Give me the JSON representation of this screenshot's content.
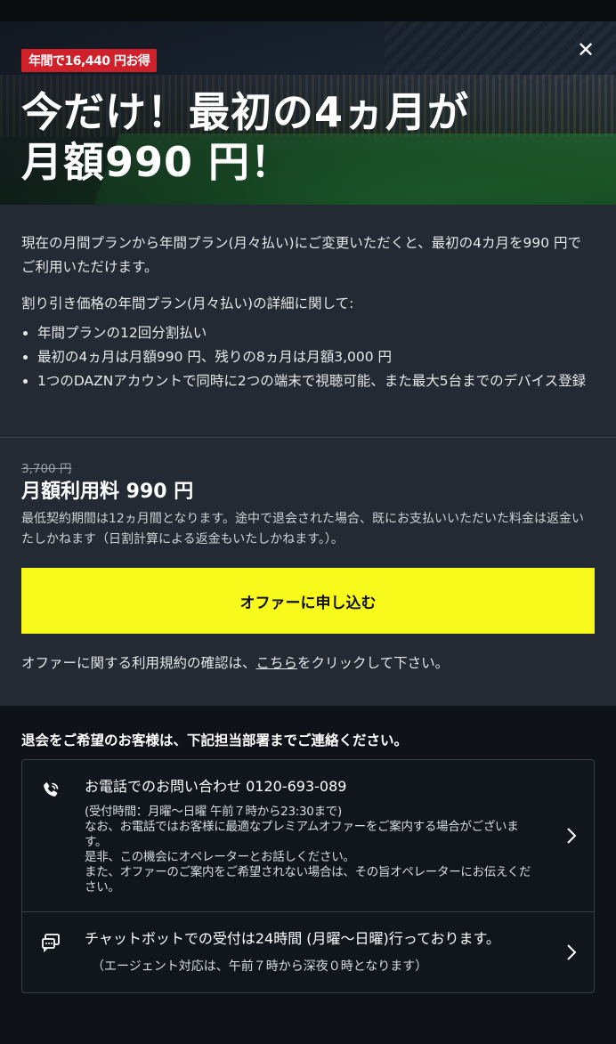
{
  "hero": {
    "badge": "年間で16,440 円お得",
    "headline_line1": "今だけ！最初の4ヵ月が",
    "headline_line2": "月額990 円！",
    "close_icon": "close-icon"
  },
  "info": {
    "lead": "現在の月間プランから年間プラン(月々払い)にご変更いただくと、最初の4カ月を990 円でご利用いただけます。",
    "details_heading": "割り引き価格の年間プラン(月々払い)の詳細に関して:",
    "bullets": [
      "年間プランの12回分割払い",
      "最初の4ヵ月は月額990 円、残りの8ヵ月は月額3,000 円",
      "1つのDAZNアカウントで同時に2つの端末で視聴可能、また最大5台までのデバイス登録"
    ]
  },
  "price": {
    "old": "3,700 円",
    "monthly": "月額利用料 990 円",
    "note": "最低契約期間は12ヵ月間となります。途中で退会された場合、既にお支払いいただいた料金は返金いたしかねます（日割計算による返金もいたしかねます。）。",
    "cta_label": "オファーに申し込む",
    "terms_before": "オファーに関する利用規約の確認は、",
    "terms_link": "こちら",
    "terms_after": "をクリックして下さい。"
  },
  "contact": {
    "title": "退会をご希望のお客様は、下記担当部署までご連絡ください。",
    "phone": {
      "title": "お電話でのお問い合わせ 0120-693-089",
      "hours": "(受付時間：月曜～日曜 午前７時から23:30まで)",
      "body": "なお、お電話ではお客様に最適なプレミアムオファーをご案内する場合がございます。\n是非、この機会にオペレーターとお話しください。\nまた、オファーのご案内をご希望されない場合は、その旨オペレーターにお伝えください。"
    },
    "chat": {
      "title": "チャットボットでの受付は24時間 (月曜～日曜)行っております。",
      "sub": "（エージェント対応は、午前７時から深夜０時となります）"
    }
  },
  "colors": {
    "cta": "#f8fa1c",
    "badge": "#d0202a",
    "panel": "#232a34",
    "background": "#0f1319"
  }
}
